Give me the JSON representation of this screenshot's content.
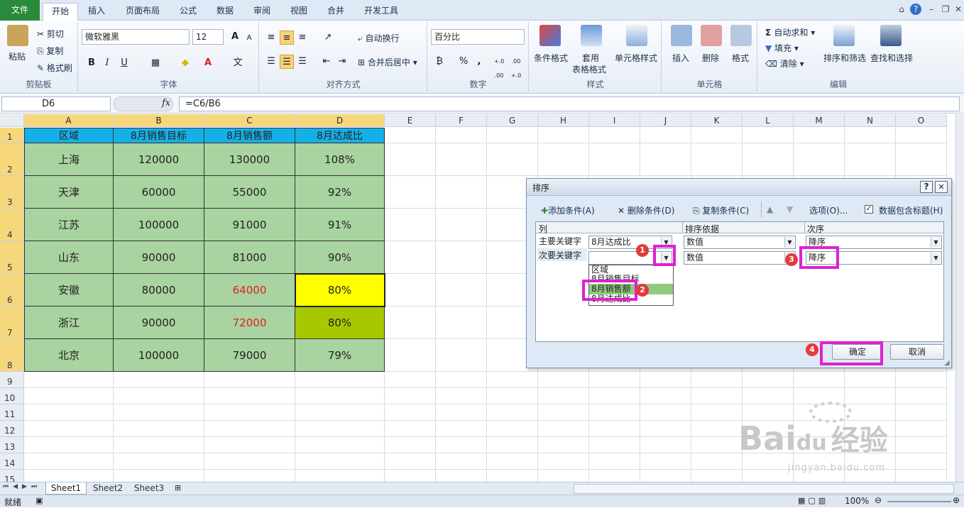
{
  "tabs": [
    "文件",
    "开始",
    "插入",
    "页面布局",
    "公式",
    "数据",
    "审阅",
    "视图",
    "合并",
    "开发工具"
  ],
  "ribbon": {
    "clipboard": {
      "paste": "粘贴",
      "cut": "剪切",
      "copy": "复制",
      "format_painter": "格式刷",
      "label": "剪贴板"
    },
    "font": {
      "name": "微软雅黑",
      "size": "12",
      "bold": "B",
      "italic": "I",
      "underline": "U",
      "label": "字体",
      "grow": "A",
      "shrink": "A"
    },
    "align": {
      "wrap": "自动换行",
      "merge": "合并后居中",
      "label": "对齐方式"
    },
    "number": {
      "format": "百分比",
      "percent": "%",
      "comma": ",",
      "label": "数字",
      "inc_dec": "+.0 .00",
      "dec_dec": ".00 +.0"
    },
    "styles": {
      "cond": "条件格式",
      "table1": "套用",
      "table2": "表格格式",
      "cell": "单元格样式",
      "label": "样式"
    },
    "cells": {
      "insert": "插入",
      "delete": "删除",
      "format": "格式",
      "label": "单元格"
    },
    "editing": {
      "autosum": "自动求和",
      "fill": "填充",
      "clear": "清除",
      "sort": "排序和筛选",
      "find": "查找和选择",
      "label": "编辑"
    }
  },
  "formula": {
    "namebox": "D6",
    "fx": "fx",
    "content": "=C6/B6"
  },
  "columns": [
    "A",
    "B",
    "C",
    "D",
    "E",
    "F",
    "G",
    "H",
    "I",
    "J",
    "K",
    "L",
    "M",
    "N",
    "O"
  ],
  "rows": [
    "1",
    "2",
    "3",
    "4",
    "5",
    "6",
    "7",
    "8",
    "9",
    "10",
    "11",
    "12",
    "13",
    "14",
    "15"
  ],
  "table": {
    "headers": [
      "区域",
      "8月销售目标",
      "8月销售额",
      "8月达成比"
    ],
    "rows": [
      [
        "上海",
        "120000",
        "130000",
        "108%"
      ],
      [
        "天津",
        "60000",
        "55000",
        "92%"
      ],
      [
        "江苏",
        "100000",
        "91000",
        "91%"
      ],
      [
        "山东",
        "90000",
        "81000",
        "90%"
      ],
      [
        "安徽",
        "80000",
        "64000",
        "80%"
      ],
      [
        "浙江",
        "90000",
        "72000",
        "80%"
      ],
      [
        "北京",
        "100000",
        "79000",
        "79%"
      ]
    ]
  },
  "sheets": [
    "Sheet1",
    "Sheet2",
    "Sheet3"
  ],
  "status": {
    "ready": "就绪",
    "zoom": "100%"
  },
  "dialog": {
    "title": "排序",
    "help": "?",
    "close": "✕",
    "add": "添加条件(A)",
    "delete": "删除条件(D)",
    "copy": "复制条件(C)",
    "options": "选项(O)...",
    "has_header": "数据包含标题(H)",
    "col_header": "列",
    "basis_header": "排序依据",
    "order_header": "次序",
    "primary_label": "主要关键字",
    "primary_value": "8月达成比",
    "primary_basis": "数值",
    "primary_order": "降序",
    "secondary_label": "次要关键字",
    "secondary_basis": "数值",
    "secondary_order": "降序",
    "dropdown": [
      "区域",
      "8月销售目标",
      "8月销售额",
      "8月达成比"
    ],
    "ok": "确定",
    "cancel": "取消",
    "badges": [
      "1",
      "2",
      "3",
      "4"
    ]
  },
  "watermark": {
    "brand": "Bai",
    "brand2": "du",
    "cn": "经验",
    "url": "jingyan.baidu.com"
  }
}
